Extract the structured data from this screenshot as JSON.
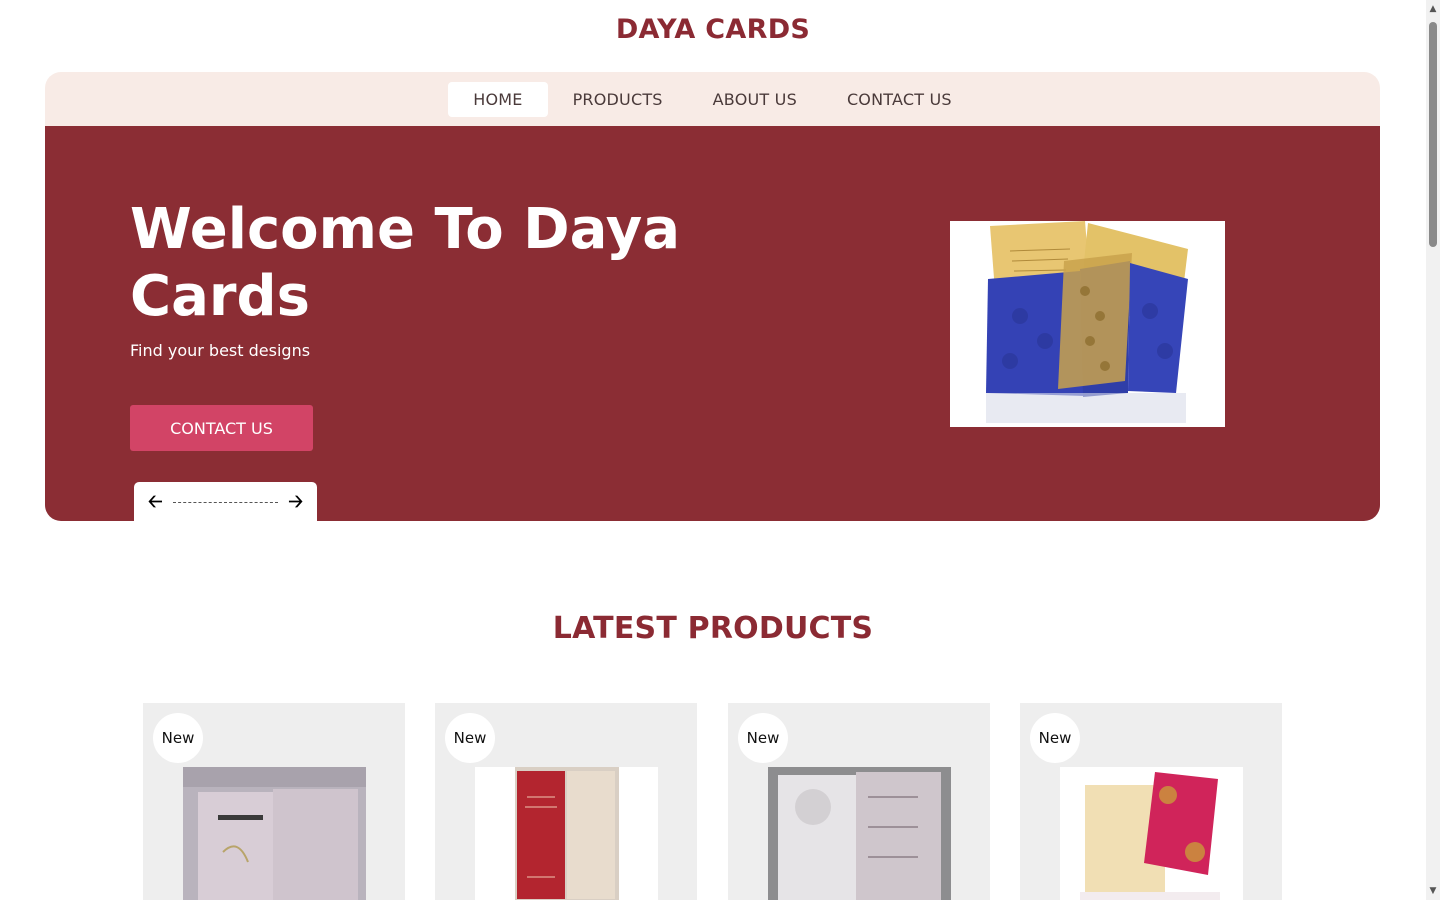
{
  "brand": {
    "name": "DAYA CARDS",
    "color": "#8b2a33"
  },
  "nav": {
    "items": [
      {
        "label": "HOME",
        "active": true
      },
      {
        "label": "PRODUCTS",
        "active": false
      },
      {
        "label": "ABOUT US",
        "active": false
      },
      {
        "label": "CONTACT US",
        "active": false
      }
    ]
  },
  "hero": {
    "title": "Welcome To Daya Cards",
    "subtitle": "Find your best designs",
    "button_label": "CONTACT US",
    "prev_icon": "arrow-left-icon",
    "next_icon": "arrow-right-icon",
    "background": "#8b2d34",
    "button_color": "#d24466"
  },
  "latest": {
    "title": "LATEST PRODUCTS",
    "products": [
      {
        "badge": "New"
      },
      {
        "badge": "New"
      },
      {
        "badge": "New"
      },
      {
        "badge": "New"
      }
    ]
  }
}
